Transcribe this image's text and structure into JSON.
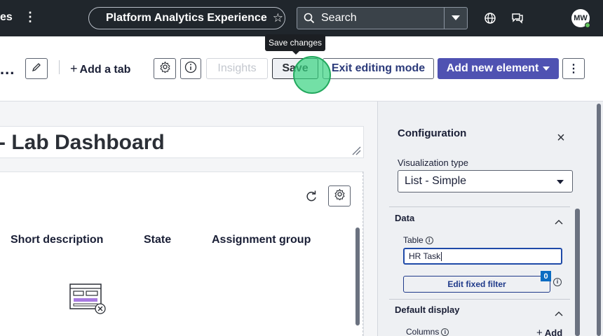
{
  "header": {
    "left_partial": "es",
    "app_name": "Platform Analytics Experience",
    "search_text": "Search",
    "avatar_initials": "MW"
  },
  "toolbar": {
    "add_tab_label": "Add a tab",
    "insights_label": "Insights",
    "save_label": "Save",
    "exit_label": "Exit editing mode",
    "add_element_label": "Add new element",
    "tooltip": "Save changes"
  },
  "canvas": {
    "dashboard_title": "- Lab Dashboard",
    "columns": [
      "Short description",
      "State",
      "Assignment group"
    ]
  },
  "config": {
    "title": "Configuration",
    "vis_type_label": "Visualization type",
    "vis_type_value": "List - Simple",
    "data_section": "Data",
    "table_label": "Table",
    "table_value": "HR Task",
    "edit_filter_label": "Edit fixed filter",
    "filter_count": "0",
    "default_display_section": "Default display",
    "columns_label": "Columns",
    "add_label": "Add"
  },
  "colors": {
    "header_bg": "#20262c",
    "primary": "#4f52b2",
    "focus": "#1f4aa8",
    "badge": "#0b6cc2"
  }
}
